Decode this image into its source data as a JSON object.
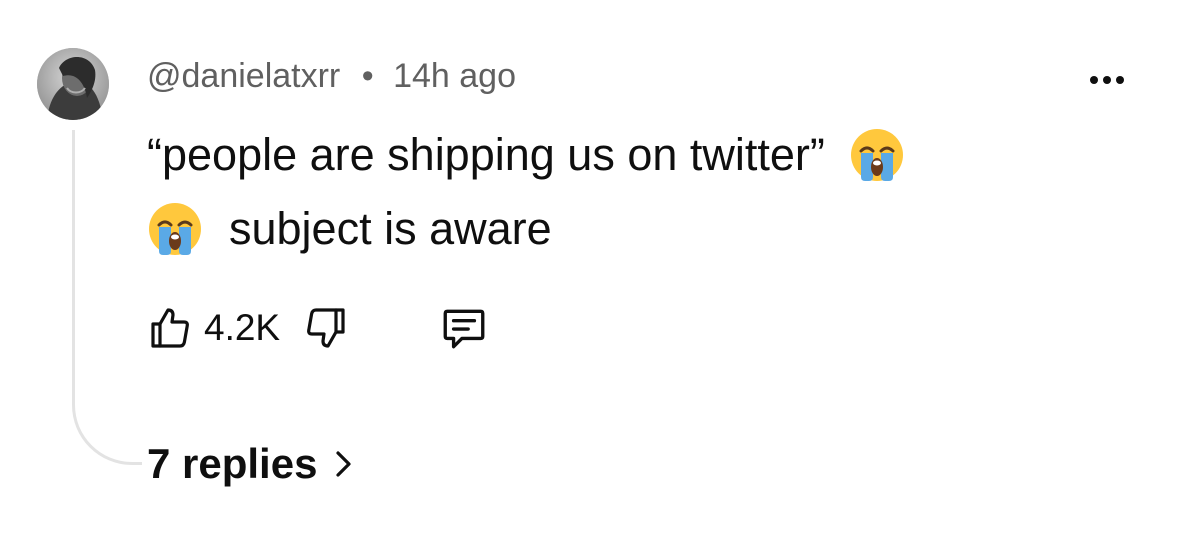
{
  "comment": {
    "username": "@danielatxrr",
    "separator": "•",
    "time": "14h ago",
    "text_line1": "“people are shipping us on twitter”",
    "text_line2": "subject is aware",
    "emoji_name": "loudly-crying-face-emoji"
  },
  "actions": {
    "like_count": "4.2K",
    "like_icon": "thumbs-up-icon",
    "dislike_icon": "thumbs-down-icon",
    "reply_icon": "comment-icon"
  },
  "replies": {
    "label": "7 replies",
    "icon": "chevron-right-icon"
  },
  "menu": {
    "icon": "more-options-icon"
  },
  "colors": {
    "text": "#0f0f0f",
    "meta": "#606060",
    "thread_line": "#e3e3e3",
    "emoji_face": "#ffc83d",
    "emoji_tears": "#5aa9e6"
  }
}
